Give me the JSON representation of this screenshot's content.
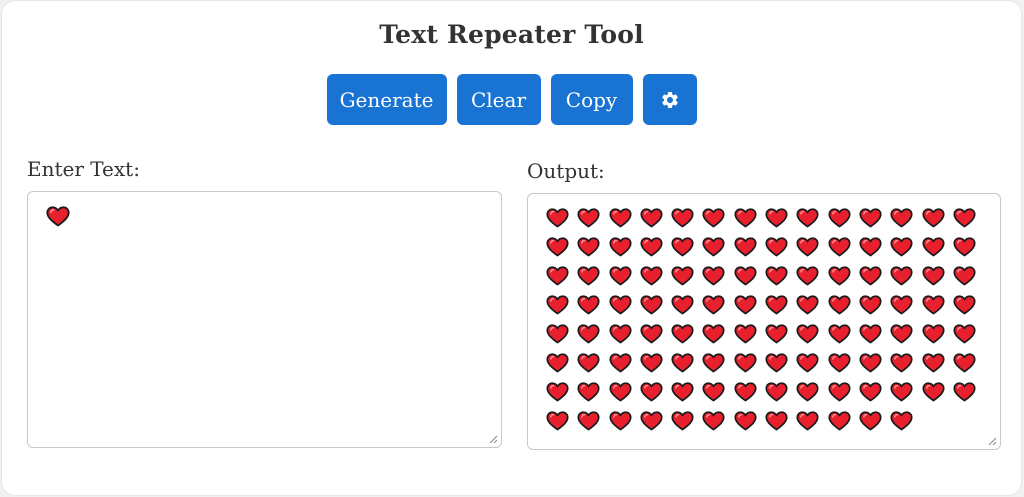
{
  "app": {
    "title": "Text Repeater Tool"
  },
  "toolbar": {
    "generate_label": "Generate",
    "clear_label": "Clear",
    "copy_label": "Copy",
    "settings_icon": "gear-icon"
  },
  "input": {
    "label": "Enter Text:",
    "value": "❤️"
  },
  "output": {
    "label": "Output:",
    "repeat_count": 110,
    "heart_icon": "heart-icon"
  },
  "colors": {
    "accent": "#1873d3",
    "heart_fill": "#e8202e",
    "heart_stroke": "#1a1a1a"
  }
}
